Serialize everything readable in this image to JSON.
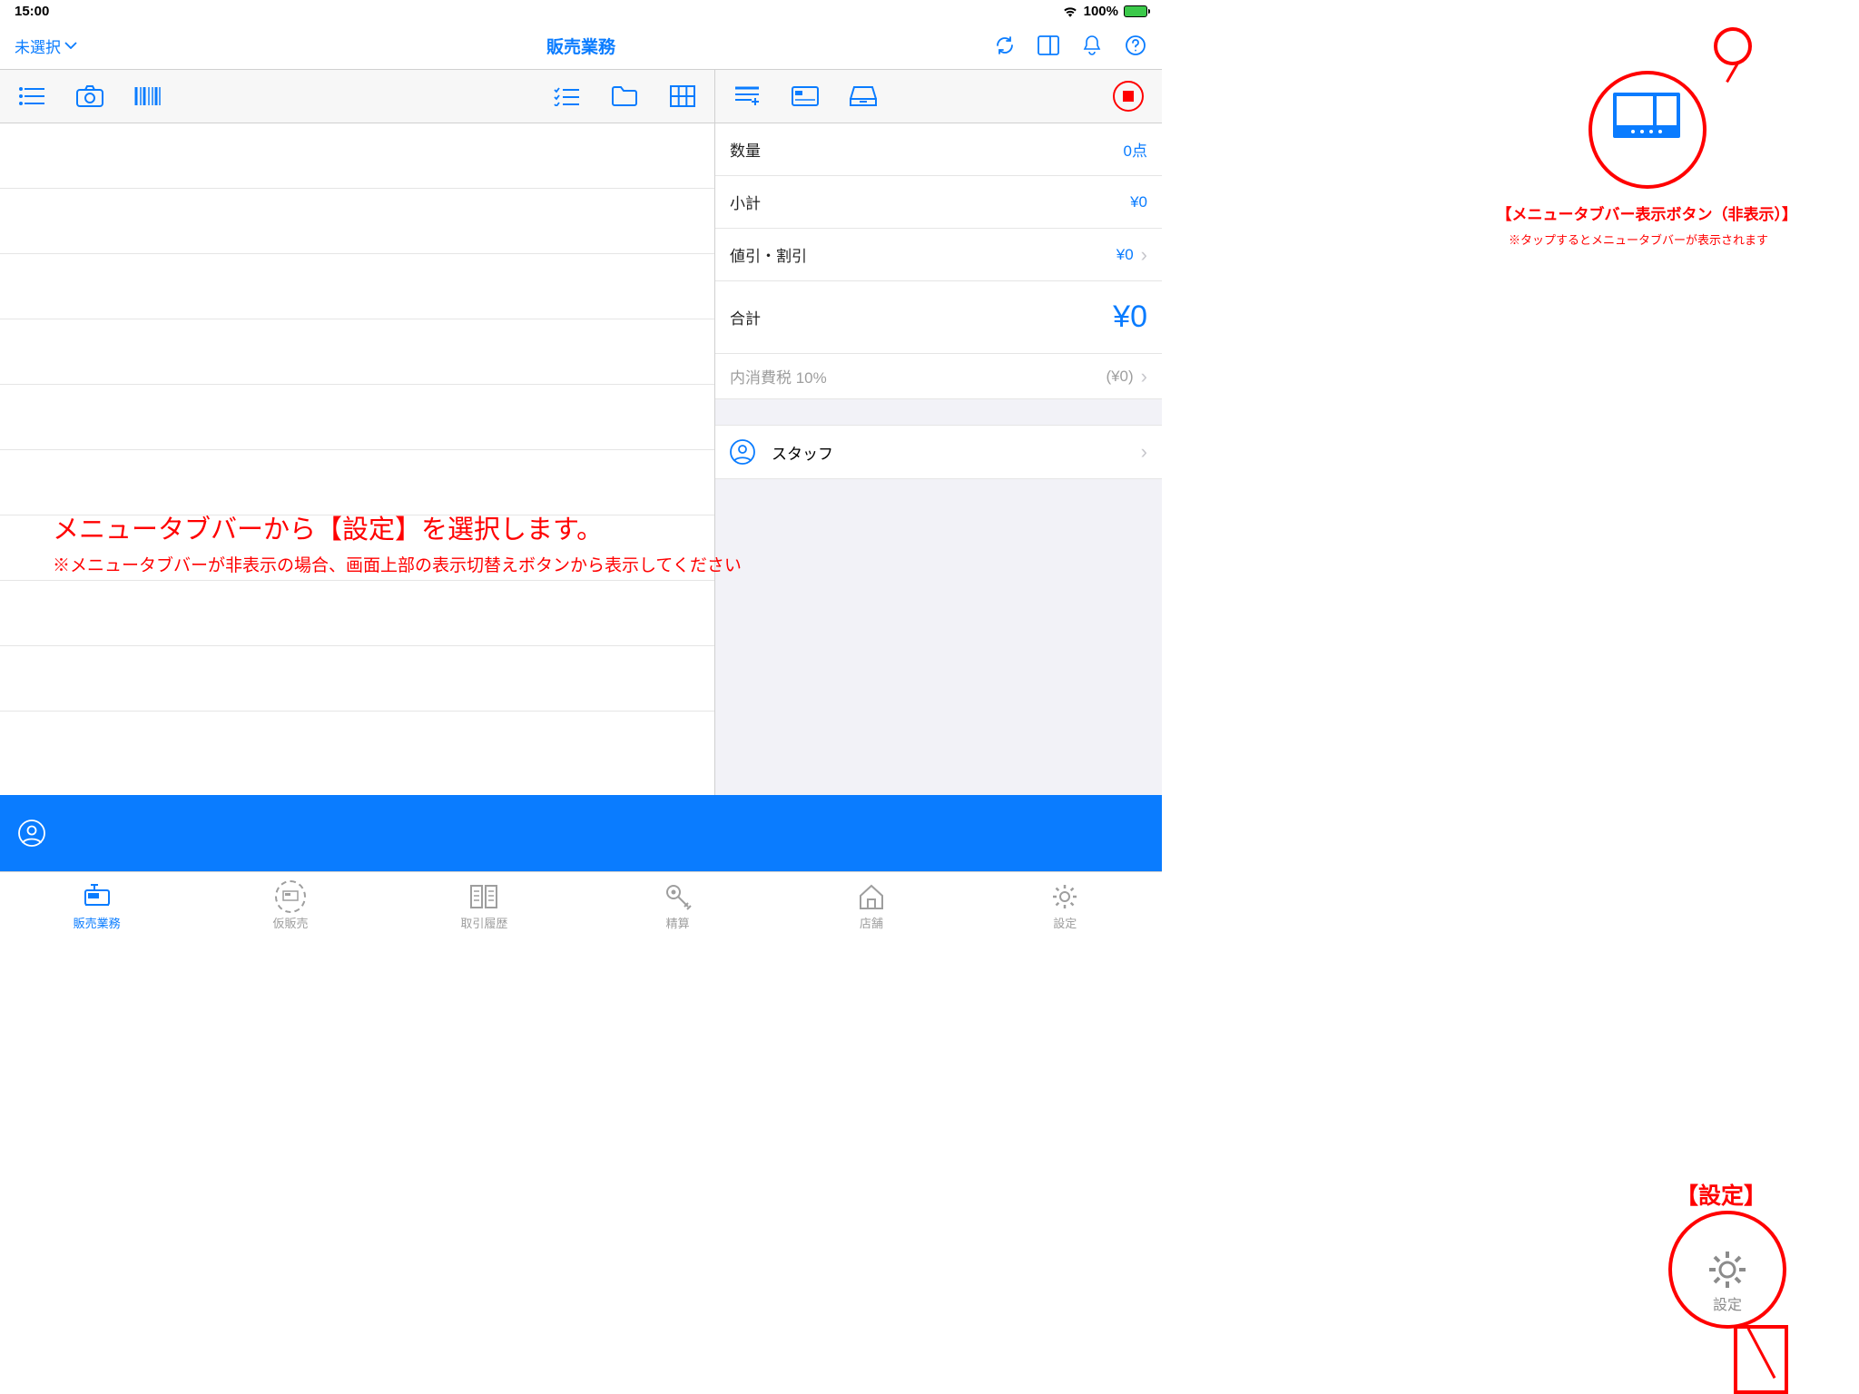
{
  "status": {
    "time": "15:00",
    "battery_text": "100%"
  },
  "nav": {
    "left_label": "未選択",
    "title": "販売業務"
  },
  "summary": {
    "qty_label": "数量",
    "qty_value": "0点",
    "subtotal_label": "小計",
    "subtotal_value": "¥0",
    "discount_label": "値引・割引",
    "discount_value": "¥0",
    "total_label": "合計",
    "total_value": "¥0",
    "tax_label": "内消費税 10%",
    "tax_value": "(¥0)",
    "staff_label": "スタッフ"
  },
  "tabs": {
    "sales": "販売業務",
    "provisional": "仮販売",
    "history": "取引履歴",
    "settlement": "精算",
    "store": "店舗",
    "settings": "設定"
  },
  "annotations": {
    "top_label": "【メニュータブバー表示ボタン（非表示）】",
    "top_sub": "※タップするとメニュータブバーが表示されます",
    "main": "メニュータブバーから【設定】を選択します。",
    "main_sub": "※メニュータブバーが非表示の場合、画面上部の表示切替えボタンから表示してください",
    "settings_label": "【設定】",
    "settings_preview_text": "設定"
  }
}
